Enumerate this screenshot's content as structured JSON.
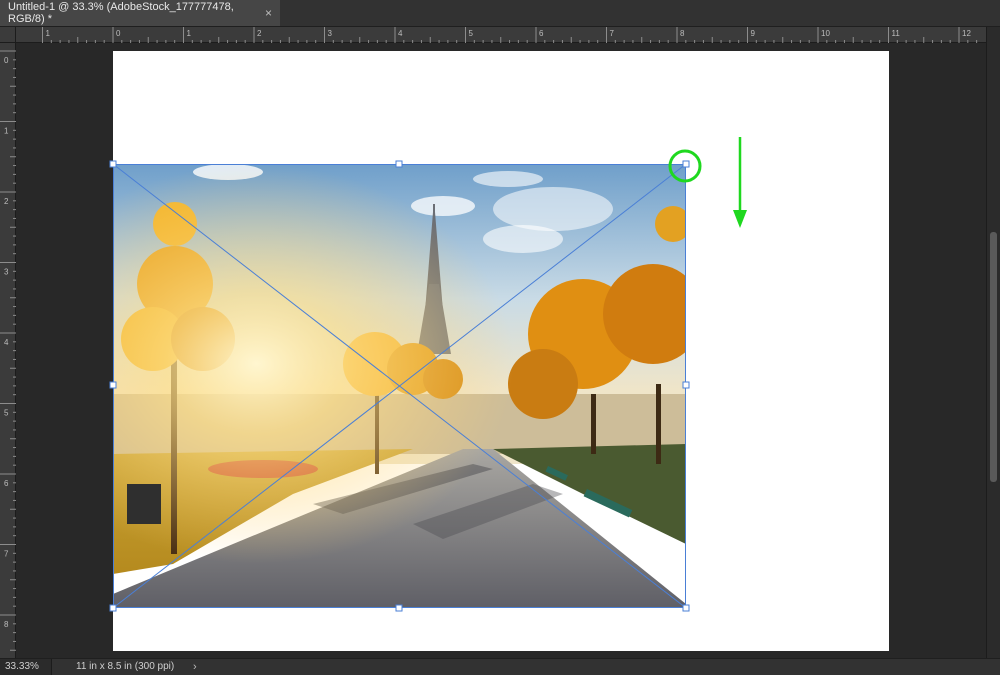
{
  "tab": {
    "title": "Untitled-1 @ 33.3% (AdobeStock_177777478, RGB/8) *",
    "close_glyph": "×"
  },
  "rulers": {
    "top_labels": [
      "1",
      "0",
      "1",
      "2",
      "3",
      "4",
      "5",
      "6",
      "7",
      "8",
      "9",
      "10",
      "11",
      "12"
    ],
    "left_labels": [
      "0",
      "1",
      "2",
      "3",
      "4",
      "5",
      "6",
      "7",
      "8"
    ]
  },
  "image": {
    "description_icon": "photo-eiffel-tower-park"
  },
  "annotation": {
    "color": "#1fd81f",
    "icons": [
      "highlight-circle",
      "down-arrow"
    ]
  },
  "status": {
    "zoom": "33.33%",
    "doc_info": "11 in x 8.5 in (300 ppi)",
    "arrow_glyph": "›"
  },
  "colors": {
    "app_bg": "#282828",
    "canvas": "#ffffff",
    "transform": "#4a7fd6"
  }
}
